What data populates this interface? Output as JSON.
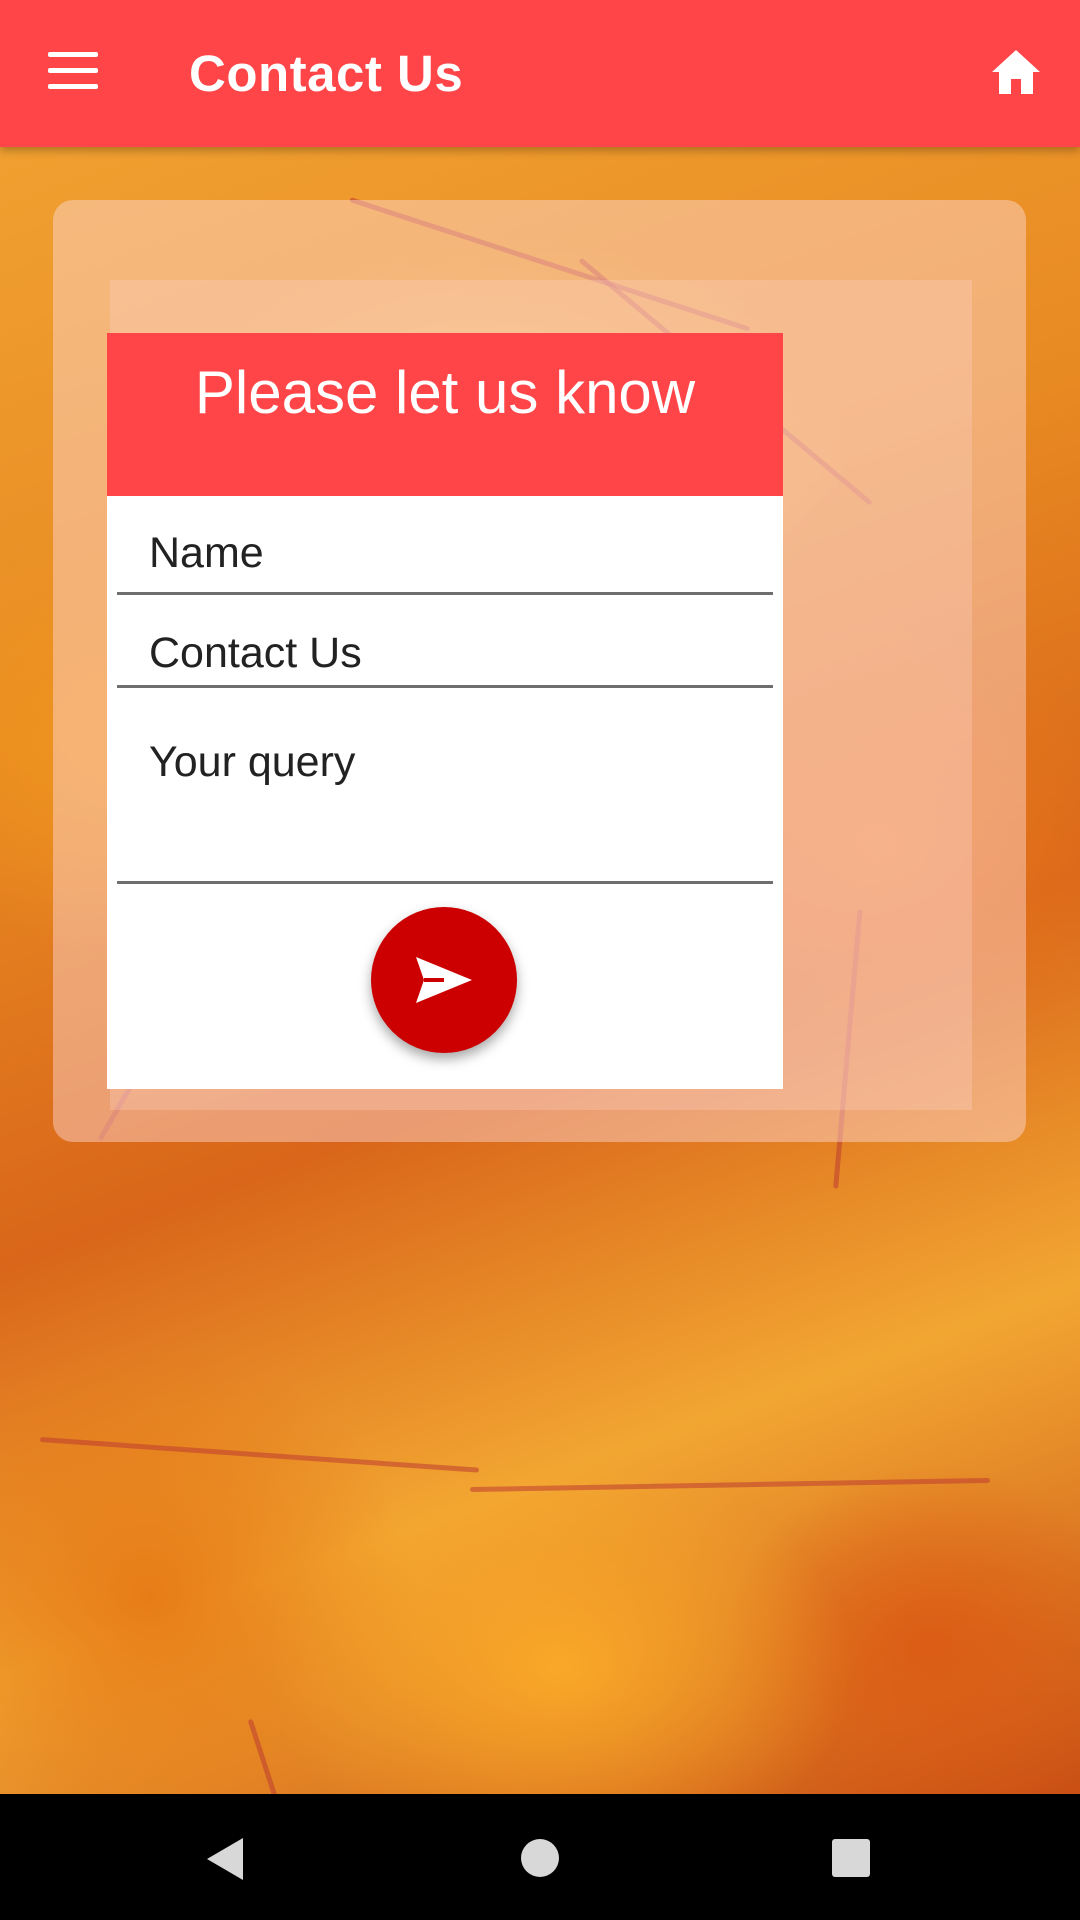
{
  "appbar": {
    "title": "Contact Us",
    "menu_icon": "hamburger-menu-icon",
    "home_icon": "home-icon",
    "color": "#ff4548"
  },
  "form": {
    "header": "Please let us know",
    "name_placeholder": "Name",
    "subject_value": "Contact Us",
    "query_placeholder": "Your query",
    "send_icon": "send-icon",
    "send_button_color": "#cc0000"
  },
  "navbar": {
    "back_icon": "back-triangle-icon",
    "home_icon": "home-circle-icon",
    "recents_icon": "recents-square-icon"
  }
}
